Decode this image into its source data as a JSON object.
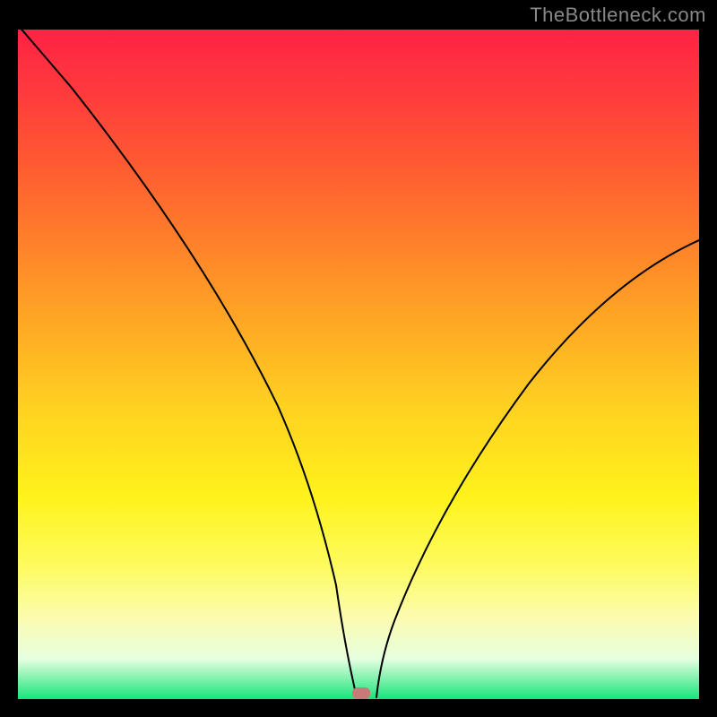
{
  "watermark": "TheBottleneck.com",
  "chart_data": {
    "type": "line",
    "title": "",
    "xlabel": "",
    "ylabel": "",
    "xlim": [
      0,
      100
    ],
    "ylim": [
      0,
      100
    ],
    "series": [
      {
        "name": "bottleneck-curve",
        "x": [
          0,
          5,
          10,
          15,
          20,
          25,
          30,
          35,
          40,
          43,
          46,
          50,
          55,
          60,
          65,
          70,
          75,
          80,
          85,
          90,
          95,
          100
        ],
        "values": [
          100,
          91,
          82,
          73,
          63,
          53,
          43,
          32,
          19,
          10,
          2,
          0,
          6,
          12,
          19,
          26,
          33,
          40,
          47,
          54,
          61,
          68
        ]
      }
    ],
    "marker": {
      "x": 50,
      "y": 0,
      "color": "#c77a78"
    },
    "background_gradient": {
      "orientation": "vertical",
      "stops": [
        {
          "pos": 0.0,
          "color": "#ff2244"
        },
        {
          "pos": 0.7,
          "color": "#fff31c"
        },
        {
          "pos": 1.0,
          "color": "#18e47a"
        }
      ]
    }
  }
}
